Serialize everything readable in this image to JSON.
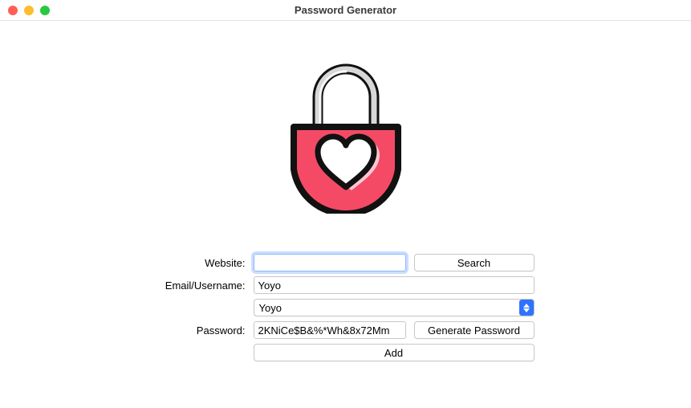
{
  "window": {
    "title": "Password Generator"
  },
  "form": {
    "website": {
      "label": "Website:",
      "value": "",
      "search_button": "Search"
    },
    "email": {
      "label": "Email/Username:",
      "value": "Yoyo",
      "select_value": "Yoyo"
    },
    "password": {
      "label": "Password:",
      "value": "2KNiCe$B&%*Wh&8x72Mm",
      "generate_button": "Generate Password"
    },
    "add_button": "Add"
  },
  "icons": {
    "lock": "lock-heart-icon",
    "select_arrows": "chevron-up-down-icon"
  },
  "colors": {
    "lock_body": "#f44a66",
    "lock_outline": "#111111",
    "lock_shackle": "#d8d8d8",
    "accent_blue": "#2f72ff"
  }
}
